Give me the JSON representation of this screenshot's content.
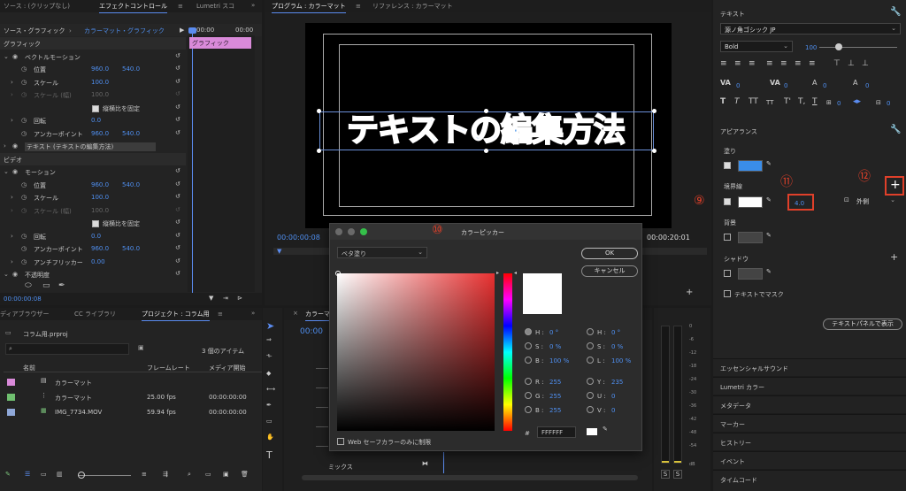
{
  "source_tab": "ソース : (クリップなし)",
  "effects_tab": "エフェクトコントロール",
  "lumetri_tab": "Lumetri スコ",
  "program_tab": "プログラム : カラーマット",
  "reference_tab": "リファレンス : カラーマット",
  "effects": {
    "header_source": "ソース・グラフィック",
    "header_seq": "カラーマット・グラフィック",
    "header_time": "00:00",
    "header_time2": "00:00",
    "clip_label": "グラフィック",
    "section_graphic": "グラフィック",
    "vector_motion": "ベクトルモーション",
    "position": "位置",
    "pos_x": "960.0",
    "pos_y": "540.0",
    "scale": "スケール",
    "scale_val": "100.0",
    "scale_w": "スケール (幅)",
    "scale_w_val": "100.0",
    "uniform_scale": "縦横比を固定",
    "rotation": "回転",
    "rotation_val": "0.0",
    "anchor": "アンカーポイント",
    "anchor_x": "960.0",
    "anchor_y": "540.0",
    "text_layer": "テキスト (テキストの編集方法)",
    "section_video": "ビデオ",
    "motion": "モーション",
    "v_position": "位置",
    "v_pos_x": "960.0",
    "v_pos_y": "540.0",
    "v_scale": "スケール",
    "v_scale_val": "100.0",
    "v_scale_w": "スケール (幅)",
    "v_scale_w_val": "100.0",
    "v_uniform": "縦横比を固定",
    "v_rotation": "回転",
    "v_rotation_val": "0.0",
    "v_anchor": "アンカーポイント",
    "v_anchor_x": "960.0",
    "v_anchor_y": "540.0",
    "antiflicker": "アンチフリッカー",
    "antiflicker_val": "0.00",
    "opacity": "不透明度",
    "timecode": "00:00:00:08"
  },
  "program": {
    "title_text": "テキストの編集方法",
    "timecode_left": "00:00:00:08",
    "timecode_right": "00:00:20:01"
  },
  "project": {
    "tab_media": "ディアブラウザー",
    "tab_cc": "CC ライブラリ",
    "tab_project": "プロジェクト : コラム用",
    "file": "コラム用.prproj",
    "items_count": "3 個のアイテム",
    "col_name": "名前",
    "col_fps": "フレームレート",
    "col_media": "メディア開始",
    "rows": [
      {
        "name": "カラーマット",
        "fps": "",
        "start": "",
        "color": "#d98ad9"
      },
      {
        "name": "カラーマット",
        "fps": "25.00 fps",
        "start": "00:00:00:00",
        "color": "#6fbf6f"
      },
      {
        "name": "IMG_7734.MOV",
        "fps": "59.94 fps",
        "start": "00:00:00:00",
        "color": "#8fa8d8"
      }
    ]
  },
  "timeline": {
    "tab": "カラーマ",
    "timecode": "00:00",
    "mix": "ミックス"
  },
  "color_picker": {
    "title": "カラーピッカー",
    "fill_type": "ベタ塗り",
    "ok": "OK",
    "cancel": "キャンセル",
    "h_label": "H :",
    "h_val": "0 °",
    "s_label": "S :",
    "s_val": "0 %",
    "b_label": "B :",
    "b_val": "100 %",
    "h2_label": "H :",
    "h2_val": "0 °",
    "s2_label": "S :",
    "s2_val": "0 %",
    "l_label": "L :",
    "l_val": "100 %",
    "r_label": "R :",
    "r_val": "255",
    "g_label": "G :",
    "g_val": "255",
    "b2_label": "B :",
    "b2_val": "255",
    "y_label": "Y :",
    "y_val": "235",
    "u_label": "U :",
    "u_val": "0",
    "v_label": "V :",
    "v_val": "0",
    "hash": "#",
    "hex": "FFFFFF",
    "web_safe": "Web セーフカラーのみに制限"
  },
  "essential": {
    "text_title": "テキスト",
    "font": "源ノ角ゴシック JP",
    "weight": "Bold",
    "size": "100",
    "tracking": "0",
    "kerning": "0",
    "leading": "0",
    "baseline": "0",
    "tsume": "0",
    "tab_val": "0",
    "appearance": "アピアランス",
    "fill": "塗り",
    "stroke": "境界線",
    "stroke_width": "4.0",
    "stroke_type": "外側",
    "background": "背景",
    "shadow": "シャドウ",
    "mask": "テキストでマスク",
    "show_panel": "テキストパネルで表示",
    "fill_color": "#3a8de8",
    "stroke_color": "#ffffff"
  },
  "right_list": [
    "エッセンシャルサウンド",
    "Lumetri カラー",
    "メタデータ",
    "マーカー",
    "ヒストリー",
    "イベント",
    "タイムコード"
  ],
  "annotations": {
    "n9": "⑨",
    "n10": "⑩",
    "n11": "⑪",
    "n12": "⑫"
  },
  "meter": {
    "s1": "S",
    "s2": "S",
    "labels": [
      "0",
      "-6",
      "-12",
      "-18",
      "-24",
      "-30",
      "-36",
      "-42",
      "-48",
      "-54",
      "dB"
    ]
  }
}
